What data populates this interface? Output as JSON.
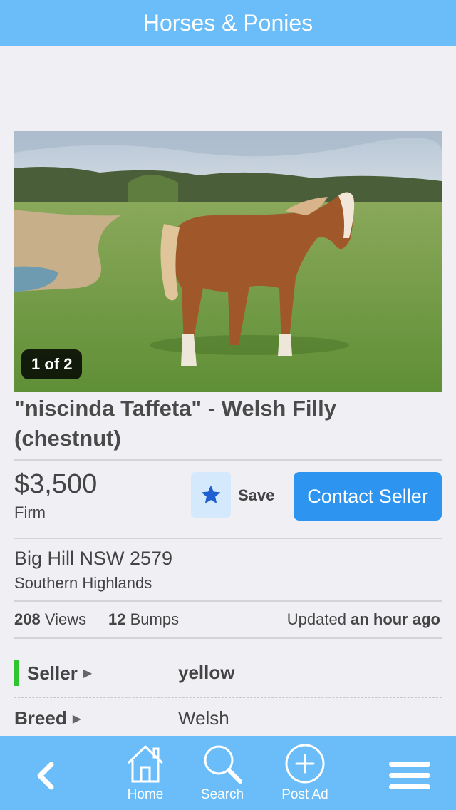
{
  "header": {
    "title": "Horses & Ponies"
  },
  "gallery": {
    "counter": "1 of 2"
  },
  "listing": {
    "title": "\"niscinda Taffeta\" - Welsh Filly (chestnut)",
    "price": "$3,500",
    "price_term": "Firm",
    "save_label": "Save",
    "contact_label": "Contact Seller",
    "location_line1": "Big Hill NSW 2579",
    "location_line2": "Southern Highlands"
  },
  "stats": {
    "views_count": "208",
    "views_label": "Views",
    "bumps_count": "12",
    "bumps_label": "Bumps",
    "updated_prefix": "Updated",
    "updated_value": "an hour ago"
  },
  "details": [
    {
      "label": "Seller",
      "value": "yellow"
    },
    {
      "label": "Breed",
      "value": "Welsh"
    }
  ],
  "tabbar": {
    "home_label": "Home",
    "search_label": "Search",
    "post_label": "Post Ad"
  },
  "icons": {
    "back": "chevron-left-icon",
    "home": "house-icon",
    "search": "magnifier-icon",
    "post": "plus-circle-icon",
    "menu": "hamburger-icon",
    "save": "star-icon"
  },
  "colors": {
    "header": "#6bbdf9",
    "accent_button": "#2d95f0",
    "seller_bar": "#2ec52e",
    "star": "#1f5fd0"
  }
}
